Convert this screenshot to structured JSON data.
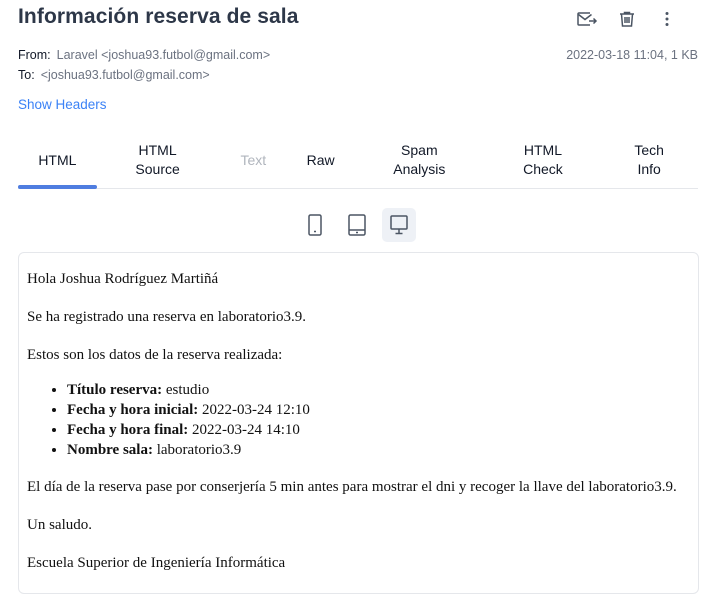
{
  "message": {
    "subject": "Información reserva de sala",
    "from_label": "From:",
    "from_value": "Laravel <joshua93.futbol@gmail.com>",
    "to_label": "To:",
    "to_value": "<joshua93.futbol@gmail.com>",
    "date_size": "2022-03-18 11:04, 1 KB",
    "show_headers": "Show Headers"
  },
  "actions": {
    "icons": [
      "forward-icon",
      "trash-icon",
      "more-vertical-icon"
    ]
  },
  "tabs": [
    {
      "label": "HTML",
      "state": "active"
    },
    {
      "label": "HTML\nSource",
      "state": "normal"
    },
    {
      "label": "Text",
      "state": "disabled"
    },
    {
      "label": "Raw",
      "state": "normal"
    },
    {
      "label": "Spam\nAnalysis",
      "state": "normal"
    },
    {
      "label": "HTML\nCheck",
      "state": "normal"
    },
    {
      "label": "Tech\nInfo",
      "state": "normal"
    }
  ],
  "devices": {
    "items": [
      "phone-icon",
      "tablet-icon",
      "desktop-icon"
    ],
    "selected": "desktop-icon"
  },
  "email": {
    "greeting": "Hola Joshua Rodríguez Martiñá",
    "line1": "Se ha registrado una reserva en laboratorio3.9.",
    "line2": "Estos son los datos de la reserva realizada:",
    "details": [
      {
        "label": "Título reserva:",
        "value": "estudio"
      },
      {
        "label": "Fecha y hora inicial:",
        "value": "2022-03-24 12:10"
      },
      {
        "label": "Fecha y hora final:",
        "value": "2022-03-24 14:10"
      },
      {
        "label": "Nombre sala:",
        "value": "laboratorio3.9"
      }
    ],
    "line3": "El día de la reserva pase por conserjería 5 min antes para mostrar el dni y recoger la llave del laboratorio3.9.",
    "closing": "Un saludo.",
    "signature": "Escuela Superior de Ingeniería Informática"
  },
  "colors": {
    "accent": "#4f7de0",
    "link": "#3b82f6",
    "icon": "#4b5563"
  }
}
